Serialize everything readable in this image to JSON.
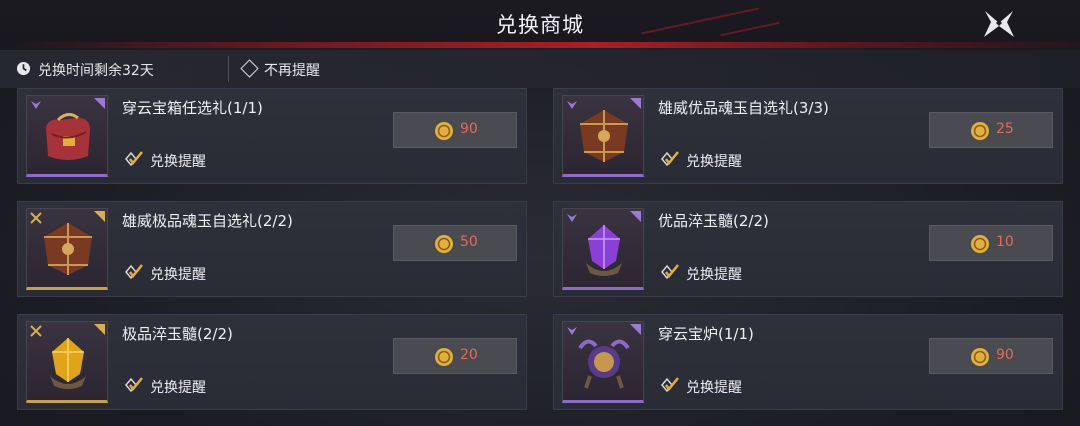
{
  "header": {
    "title": "兑换商城"
  },
  "info": {
    "timer_text": "兑换时间剩余32天",
    "no_remind_text": "不再提醒"
  },
  "items": [
    {
      "name": "穿云宝箱任选礼(1/1)",
      "price": "90",
      "remind": "兑换提醒",
      "rarity": "purple"
    },
    {
      "name": "雄威优品魂玉自选礼(3/3)",
      "price": "25",
      "remind": "兑换提醒",
      "rarity": "purple"
    },
    {
      "name": "雄威极品魂玉自选礼(2/2)",
      "price": "50",
      "remind": "兑换提醒",
      "rarity": "gold"
    },
    {
      "name": "优品淬玉髓(2/2)",
      "price": "10",
      "remind": "兑换提醒",
      "rarity": "purple"
    },
    {
      "name": "极品淬玉髓(2/2)",
      "price": "20",
      "remind": "兑换提醒",
      "rarity": "gold"
    },
    {
      "name": "穿云宝炉(1/1)",
      "price": "90",
      "remind": "兑换提醒",
      "rarity": "purple"
    }
  ],
  "colors": {
    "price": "#e46a5a",
    "purple": "#8a6cc6",
    "gold": "#c9a04a",
    "coin": "#e0b23c"
  },
  "icons": [
    "clock-icon",
    "close-x-icon",
    "diamond-checkbox-icon",
    "coin-icon",
    "check-icon"
  ]
}
